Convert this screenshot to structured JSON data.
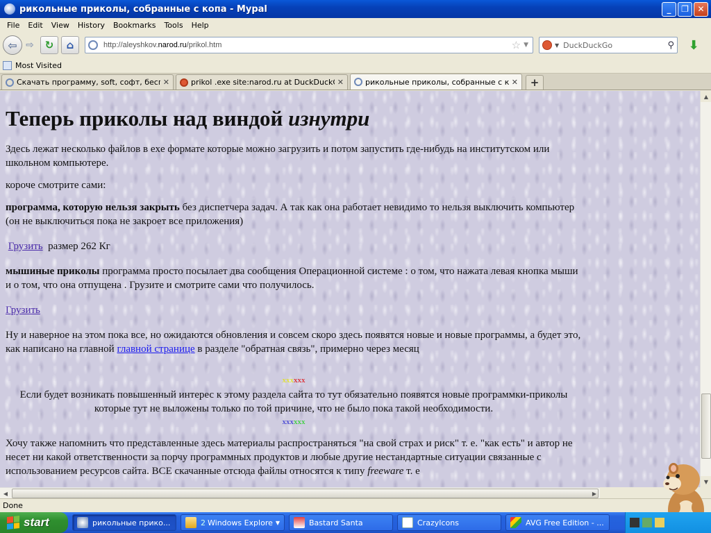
{
  "window": {
    "title": "рикольные приколы, собранные с копа - Mypal"
  },
  "menu": [
    "File",
    "Edit",
    "View",
    "History",
    "Bookmarks",
    "Tools",
    "Help"
  ],
  "navbar": {
    "url_prefix": "http://aleyshkov.",
    "url_domain": "narod.ru",
    "url_path": "/prikol.htm",
    "search_placeholder": "DuckDuckGo"
  },
  "bookmarks": {
    "most_visited": "Most Visited"
  },
  "tabs": [
    {
      "label": "Скачать программу, soft, софт, беспл...",
      "icon": "page-icon"
    },
    {
      "label": "prikol .exe site:narod.ru at DuckDuckGo",
      "icon": "duckduckgo-icon"
    },
    {
      "label": "рикольные приколы, собранные с копа",
      "icon": "page-icon",
      "active": true
    }
  ],
  "content": {
    "heading_plain": "Теперь приколы над виндой ",
    "heading_italic": "изнутри",
    "intro": "Здесь лежат несколько файлов в exe формате которые можно загрузить и потом запустить где-нибудь на институтском или школьном компьютере.",
    "short": "короче смотрите сами:",
    "prog1_bold": "программа, которую нельзя закрыть",
    "prog1_text": " без диспетчера задач. А так как она работает невидимо то нельзя выключить компьютер (он не выключиться пока не закроет все приложения)",
    "download1_link": "Грузить",
    "download1_size": " размер 262 Кг",
    "prog2_bold": "мышиные приколы",
    "prog2_text": " программа просто посылает два сообщения Операционной системе : о том, что нажата левая кнопка мыши и о том, что она отпущена . Грузите и смотрите сами что получилось.",
    "download2_link": "Грузить",
    "update_text_1": "Ну и наверное на этом пока все, но ожидаются обновления и совсем скоро здесь появятся новые и новые программы, а будет это, как написано на главной ",
    "main_page_link": "главной странице",
    "update_text_2": " в разделе \"обратная связь\",  примерно через месяц",
    "mark_top_1": "xxx",
    "mark_top_2": "xxx",
    "interest_text": "Если будет возникать повышенный интерес к этому раздела сайта то тут обязательно появятся новые программки-приколы которые тут не выложены только по той причине, что не было пока такой необходимости.",
    "mark_bottom_1": "xxx",
    "mark_bottom_2": "xxx",
    "disclaimer_1": "Хочу также напомнить что представленные здесь материалы распространяться \"на свой страх и риск\" т. е. \"как есть\" и автор не несет ни какой ответственности за порчу программных продуктов и любые другие нестандартные ситуации связанные с использованием ресурсов сайта. ВСЕ скачанные отсюда файлы относятся к типу ",
    "disclaimer_italic": "freeware",
    "disclaimer_2": " т. е"
  },
  "status": {
    "text": "Done"
  },
  "taskbar": {
    "start": "start",
    "tasks": [
      {
        "label": "рикольные прико...",
        "active": true
      },
      {
        "count": "2",
        "label": "Windows Explorer"
      },
      {
        "label": "Bastard Santa"
      },
      {
        "label": "CrazyIcons"
      },
      {
        "label": "AVG Free Edition - ..."
      }
    ]
  },
  "colors": {
    "page_bg": "#cfcce0",
    "link": "#4b2caa",
    "taskbar": "#245edb",
    "start": "#2f8f2f"
  }
}
